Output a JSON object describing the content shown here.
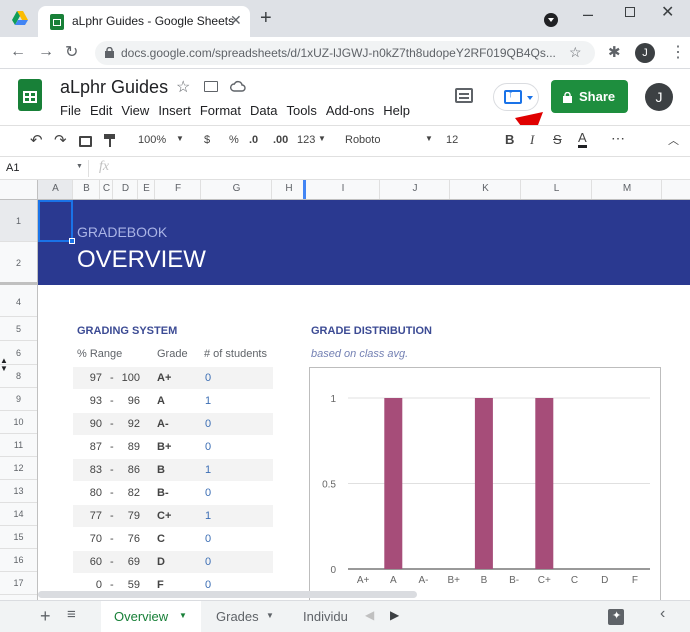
{
  "browser": {
    "tab_title": "aLphr Guides - Google Sheets",
    "url": "docs.google.com/spreadsheets/d/1xUZ-lJGWJ-n0kZ7th8udopeY2RF019QB4Qs...",
    "profile_initial": "J"
  },
  "doc": {
    "title": "aLphr Guides",
    "menu": [
      "File",
      "Edit",
      "View",
      "Insert",
      "Format",
      "Data",
      "Tools",
      "Add-ons",
      "Help"
    ],
    "share_label": "Share",
    "avatar_initial": "J"
  },
  "toolbar": {
    "zoom": "100%",
    "currency": "$",
    "percent": "%",
    "dec_less": ".0",
    "dec_more": ".00",
    "format": "123",
    "font": "Roboto",
    "size": "12"
  },
  "formula": {
    "cell_ref": "A1",
    "fx": "fx"
  },
  "columns": [
    "A",
    "B",
    "C",
    "D",
    "E",
    "F",
    "G",
    "H",
    "I",
    "J",
    "K",
    "L",
    "M"
  ],
  "rows": [
    "1",
    "2",
    "4",
    "5",
    "6",
    "8",
    "9",
    "10",
    "11",
    "12",
    "13",
    "14",
    "15",
    "16",
    "17"
  ],
  "banner": {
    "subtitle": "GRADEBOOK",
    "title": "OVERVIEW",
    "color": "#2a3990"
  },
  "grading": {
    "title": "GRADING SYSTEM",
    "headers": [
      "% Range",
      "Grade",
      "# of students"
    ],
    "rows": [
      {
        "lo": "97",
        "hi": "100",
        "grade": "A+",
        "count": "0"
      },
      {
        "lo": "93",
        "hi": "96",
        "grade": "A",
        "count": "1"
      },
      {
        "lo": "90",
        "hi": "92",
        "grade": "A-",
        "count": "0"
      },
      {
        "lo": "87",
        "hi": "89",
        "grade": "B+",
        "count": "0"
      },
      {
        "lo": "83",
        "hi": "86",
        "grade": "B",
        "count": "1"
      },
      {
        "lo": "80",
        "hi": "82",
        "grade": "B-",
        "count": "0"
      },
      {
        "lo": "77",
        "hi": "79",
        "grade": "C+",
        "count": "1"
      },
      {
        "lo": "70",
        "hi": "76",
        "grade": "C",
        "count": "0"
      },
      {
        "lo": "60",
        "hi": "69",
        "grade": "D",
        "count": "0"
      },
      {
        "lo": "0",
        "hi": "59",
        "grade": "F",
        "count": "0"
      }
    ]
  },
  "distribution": {
    "title": "GRADE DISTRIBUTION",
    "subtitle": "based on class avg."
  },
  "chart_data": {
    "type": "bar",
    "categories": [
      "A+",
      "A",
      "A-",
      "B+",
      "B",
      "B-",
      "C+",
      "C",
      "D",
      "F"
    ],
    "values": [
      0,
      1,
      0,
      0,
      1,
      0,
      1,
      0,
      0,
      0
    ],
    "ylim": [
      0,
      1
    ],
    "yticks": [
      "0",
      "0.5",
      "1"
    ],
    "bar_color": "#a64d79",
    "grid": true
  },
  "sheets": [
    {
      "label": "Overview",
      "active": true
    },
    {
      "label": "Grades",
      "active": false
    },
    {
      "label": "Individu",
      "active": false
    }
  ],
  "colors": {
    "sheets_green": "#188038",
    "share_green": "#1e8e3e",
    "accent_blue": "#1a73e8",
    "arrow_red": "#e00000"
  }
}
